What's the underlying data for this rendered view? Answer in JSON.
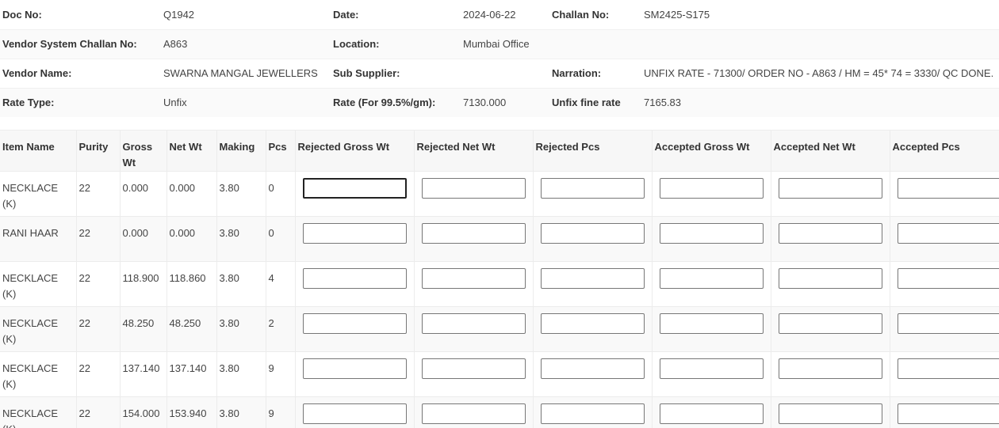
{
  "header": {
    "rows": [
      [
        {
          "label": "Doc No:",
          "value": "Q1942"
        },
        {
          "label": "Date:",
          "value": "2024-06-22"
        },
        {
          "label": "Challan No:",
          "value": "SM2425-S175"
        }
      ],
      [
        {
          "label": "Vendor System Challan No:",
          "value": "A863"
        },
        {
          "label": "Location:",
          "value": "Mumbai Office"
        },
        {
          "label": "",
          "value": ""
        }
      ],
      [
        {
          "label": "Vendor Name:",
          "value": "SWARNA MANGAL JEWELLERS"
        },
        {
          "label": "Sub Supplier:",
          "value": ""
        },
        {
          "label": "Narration:",
          "value": "UNFIX RATE - 71300/ ORDER NO - A863 / HM = 45* 74 = 3330/ QC DONE."
        }
      ],
      [
        {
          "label": "Rate Type:",
          "value": "Unfix"
        },
        {
          "label": "Rate (For 99.5%/gm):",
          "value": "7130.000"
        },
        {
          "label": "Unfix fine rate",
          "value": "7165.83"
        }
      ]
    ]
  },
  "items": {
    "columns": [
      "Item Name",
      "Purity",
      "Gross Wt",
      "Net Wt",
      "Making",
      "Pcs",
      "Rejected Gross Wt",
      "Rejected Net Wt",
      "Rejected Pcs",
      "Accepted Gross Wt",
      "Accepted Net Wt",
      "Accepted Pcs"
    ],
    "rows": [
      {
        "item_name": "NECKLACE (K)",
        "purity": "22",
        "gross_wt": "0.000",
        "net_wt": "0.000",
        "making": "3.80",
        "pcs": "0"
      },
      {
        "item_name": "RANI HAAR",
        "purity": "22",
        "gross_wt": "0.000",
        "net_wt": "0.000",
        "making": "3.80",
        "pcs": "0"
      },
      {
        "item_name": "NECKLACE (K)",
        "purity": "22",
        "gross_wt": "118.900",
        "net_wt": "118.860",
        "making": "3.80",
        "pcs": "4"
      },
      {
        "item_name": "NECKLACE (K)",
        "purity": "22",
        "gross_wt": "48.250",
        "net_wt": "48.250",
        "making": "3.80",
        "pcs": "2"
      },
      {
        "item_name": "NECKLACE (K)",
        "purity": "22",
        "gross_wt": "137.140",
        "net_wt": "137.140",
        "making": "3.80",
        "pcs": "9"
      },
      {
        "item_name": "NECKLACE (K)",
        "purity": "22",
        "gross_wt": "154.000",
        "net_wt": "153.940",
        "making": "3.80",
        "pcs": "9"
      }
    ]
  }
}
